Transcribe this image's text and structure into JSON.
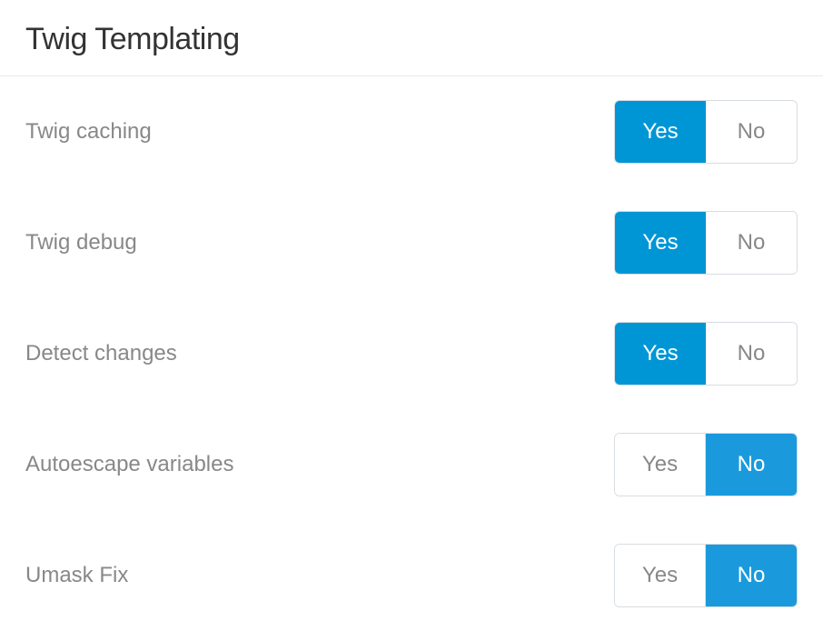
{
  "section": {
    "title": "Twig Templating"
  },
  "options": {
    "yes": "Yes",
    "no": "No"
  },
  "settings": [
    {
      "id": "twig-caching",
      "label": "Twig caching",
      "value": "yes"
    },
    {
      "id": "twig-debug",
      "label": "Twig debug",
      "value": "yes"
    },
    {
      "id": "detect-changes",
      "label": "Detect changes",
      "value": "yes"
    },
    {
      "id": "autoescape-variables",
      "label": "Autoescape variables",
      "value": "no"
    },
    {
      "id": "umask-fix",
      "label": "Umask Fix",
      "value": "no"
    }
  ]
}
